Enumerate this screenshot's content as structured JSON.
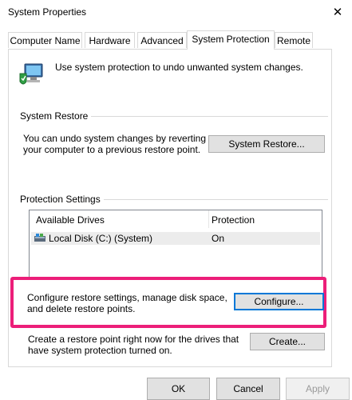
{
  "window": {
    "title": "System Properties",
    "close_glyph": "✕"
  },
  "tabs": [
    {
      "label": "Computer Name",
      "active": false
    },
    {
      "label": "Hardware",
      "active": false
    },
    {
      "label": "Advanced",
      "active": false
    },
    {
      "label": "System Protection",
      "active": true
    },
    {
      "label": "Remote",
      "active": false
    }
  ],
  "intro": {
    "text": "Use system protection to undo unwanted system changes.",
    "icon": "system-protection-icon"
  },
  "system_restore": {
    "group_label": "System Restore",
    "description": "You can undo system changes by reverting your computer to a previous restore point.",
    "button_label": "System Restore..."
  },
  "protection": {
    "group_label": "Protection Settings",
    "columns": [
      "Available Drives",
      "Protection"
    ],
    "drives": [
      {
        "name": "Local Disk (C:) (System)",
        "protection": "On",
        "icon": "drive-icon"
      }
    ],
    "configure_text": "Configure restore settings, manage disk space, and delete restore points.",
    "configure_label": "Configure...",
    "create_text": "Create a restore point right now for the drives that have system protection turned on.",
    "create_label": "Create..."
  },
  "footer": {
    "ok": "OK",
    "cancel": "Cancel",
    "apply": "Apply"
  },
  "colors": {
    "highlight": "#ec1e79",
    "focus": "#0078d7"
  }
}
